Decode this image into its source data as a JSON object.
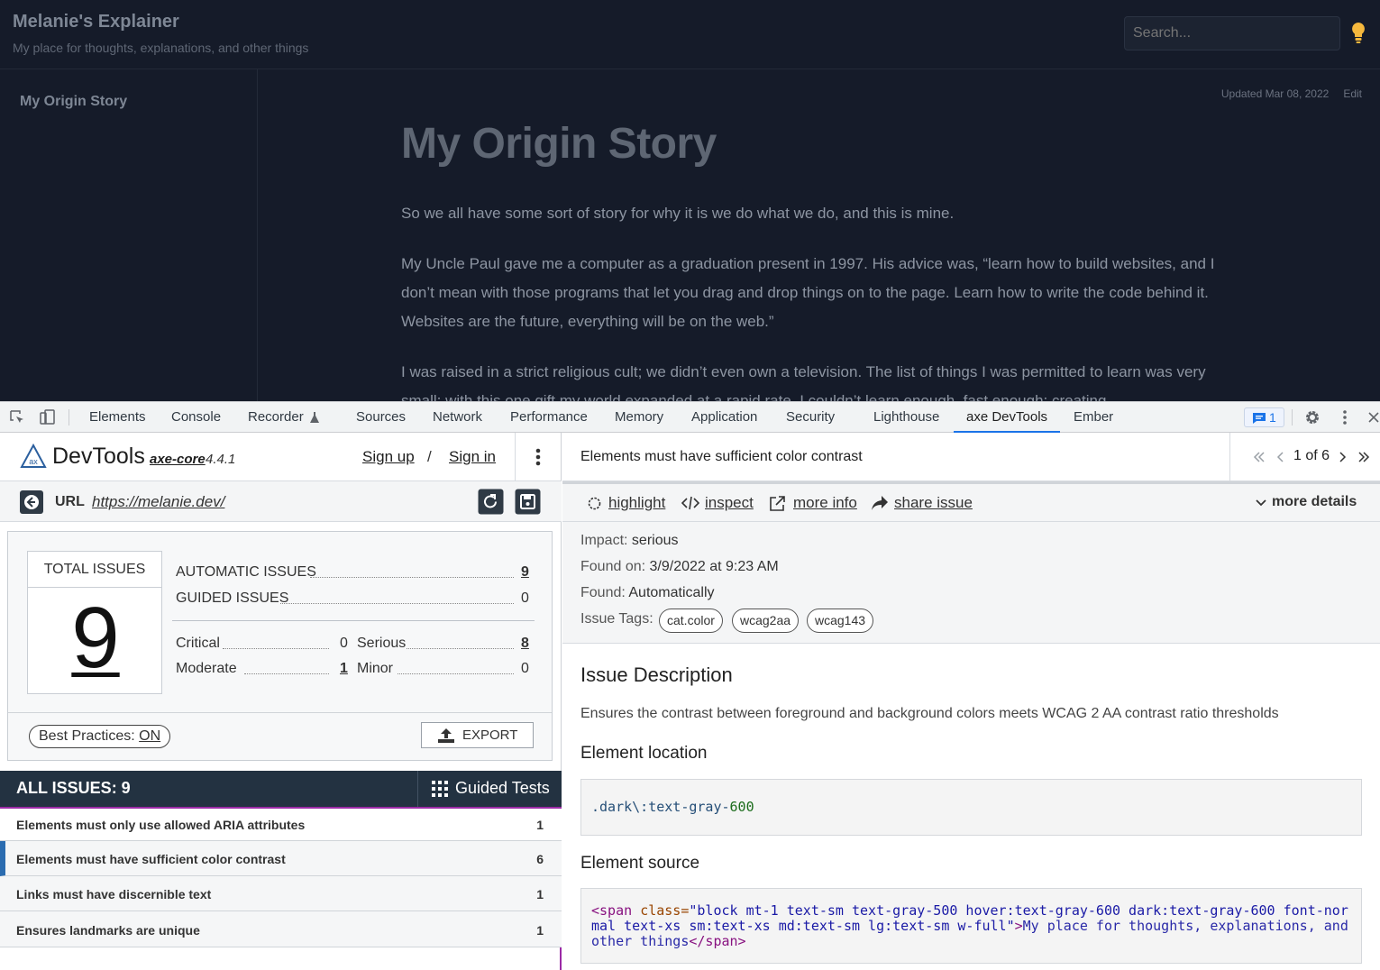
{
  "site": {
    "title": "Melanie's Explainer",
    "subtitle": "My place for thoughts, explanations, and other things",
    "search_placeholder": "Search...",
    "sidebar_item": "My Origin Story",
    "updated": "Updated Mar 08, 2022",
    "edit": "Edit",
    "heading": "My Origin Story",
    "para1": "So we all have some sort of story for why it is we do what we do, and this is mine.",
    "para2": "My Uncle Paul gave me a computer as a graduation present in 1997. His advice was, “learn how to build websites, and I don’t mean with those programs that let you drag and drop things on to the page. Learn how to write the code behind it. Websites are the future, everything will be on the web.”",
    "para3": "I was raised in a strict religious cult; we didn’t even own a television. The list of things I was permitted to learn was very small; with this one gift my world expanded at a rapid rate. I couldn’t learn enough, fast enough; creating"
  },
  "devtools_tabs": [
    "Elements",
    "Console",
    "Recorder",
    "Sources",
    "Network",
    "Performance",
    "Memory",
    "Application",
    "Security",
    "Lighthouse",
    "axe DevTools",
    "Ember"
  ],
  "devtools_badge": "1",
  "axe": {
    "brand": "DevTools",
    "engine": "axe-core",
    "version": "4.4.1",
    "sign_up": "Sign up",
    "slash": "/",
    "sign_in": "Sign in",
    "url_label": "URL",
    "url": "https://melanie.dev/",
    "total_label": "TOTAL ISSUES",
    "total": "9",
    "automatic_label": "AUTOMATIC ISSUES",
    "automatic": "9",
    "guided_label": "GUIDED ISSUES",
    "guided": "0",
    "critical_label": "Critical",
    "critical": "0",
    "serious_label": "Serious",
    "serious": "8",
    "moderate_label": "Moderate",
    "moderate": "1",
    "minor_label": "Minor",
    "minor": "0",
    "best_practices": "Best Practices:",
    "best_practices_value": "ON",
    "export": "EXPORT",
    "all_issues": "ALL ISSUES: 9",
    "guided_tests": "Guided Tests",
    "issues": [
      {
        "label": "Elements must only use allowed ARIA attributes",
        "count": "1"
      },
      {
        "label": "Elements must have sufficient color contrast",
        "count": "6"
      },
      {
        "label": "Links must have discernible text",
        "count": "1"
      },
      {
        "label": "Ensures landmarks are unique",
        "count": "1"
      }
    ]
  },
  "detail": {
    "title": "Elements must have sufficient color contrast",
    "pager": "1 of 6",
    "highlight": "highlight",
    "inspect": "inspect",
    "more_info": "more info",
    "share_issue": "share issue",
    "more_details": "more details",
    "impact_label": "Impact:",
    "impact": "serious",
    "found_on_label": "Found on:",
    "found_on": "3/9/2022 at 9:23 AM",
    "found_label": "Found:",
    "found": "Automatically",
    "tags_label": "Issue Tags:",
    "tags": [
      "cat.color",
      "wcag2aa",
      "wcag143"
    ],
    "desc_heading": "Issue Description",
    "desc": "Ensures the contrast between foreground and background colors meets WCAG 2 AA contrast ratio thresholds",
    "loc_heading": "Element location",
    "loc_class": ".dark\\:text-gray-",
    "loc_num": "600",
    "src_heading": "Element source",
    "src_open": "<span ",
    "src_attr": "class=",
    "src_val": "\"block mt-1 text-sm text-gray-500 hover:text-gray-600 dark:text-gray-600 font-normal text-xs sm:text-xs md:text-sm lg:text-sm w-full\"",
    "src_gt": ">",
    "src_text": "My place for thoughts, explanations, and other things",
    "src_close": "</span>"
  }
}
